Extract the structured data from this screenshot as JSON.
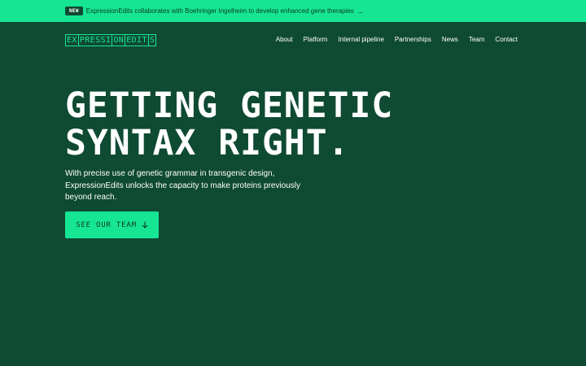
{
  "banner": {
    "badge": "NEW",
    "text": "ExpressionEdits collaborates with Boehringer Ingelheim to develop enhanced gene therapies",
    "arrow": "→"
  },
  "logo": {
    "segments": [
      "EX",
      "PRESSI",
      "ON",
      "EDIT",
      "S"
    ]
  },
  "nav": {
    "items": [
      {
        "label": "About"
      },
      {
        "label": "Platform"
      },
      {
        "label": "Internal pipeline"
      },
      {
        "label": "Partnerships"
      },
      {
        "label": "News"
      },
      {
        "label": "Team"
      },
      {
        "label": "Contact"
      }
    ]
  },
  "hero": {
    "headline_line1": "GETTING GENETIC",
    "headline_line2": "SYNTAX RIGHT.",
    "lead": "With precise use of genetic grammar in transgenic design, ExpressionEdits unlocks the capacity to make proteins previously beyond reach.",
    "cta_label": "SEE OUR TEAM",
    "cta_icon": "arrow-down-icon"
  },
  "colors": {
    "background": "#0f4a33",
    "accent": "#16e694",
    "text": "#ffffff"
  }
}
